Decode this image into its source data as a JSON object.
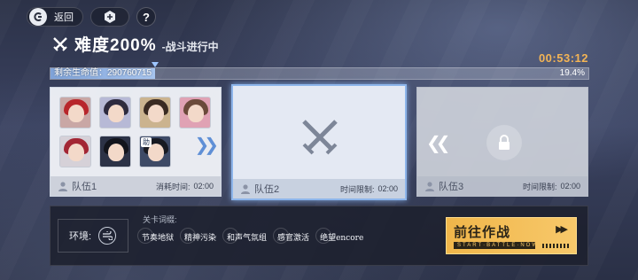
{
  "topbar": {
    "back_label": "返回",
    "help_label": "?"
  },
  "header": {
    "difficulty_title": "难度200%",
    "status": "-战斗进行中",
    "timer": "00:53:12"
  },
  "boss_hp": {
    "label": "剩余生命值：290760715",
    "percent_text": "19.4%",
    "remaining_fraction": 0.194
  },
  "teams": [
    {
      "name": "队伍1",
      "time_label": "消耗时间:",
      "time_value": "02:00",
      "assist_tag": "助"
    },
    {
      "name": "队伍2",
      "time_label": "时间限制:",
      "time_value": "02:00"
    },
    {
      "name": "队伍3",
      "time_label": "时间限制:",
      "time_value": "02:00"
    }
  ],
  "environment": {
    "label": "环境:"
  },
  "affixes": {
    "title": "关卡词缀:",
    "items": [
      "节奏地狱",
      "精神污染",
      "和声气氛组",
      "感官激活",
      "绝望encore"
    ]
  },
  "go_button": {
    "label": "前往作战",
    "sub": "START·BATTLE·NOW"
  },
  "colors": {
    "accent_blue": "#8db5ea",
    "timer_gold": "#f3b455",
    "button_gold": "#f0b64a",
    "hp_fill": "#7fa3d9"
  },
  "icons": {
    "top_home": "return-icon",
    "top_tool": "hexagon-tool-icon",
    "title": "crossed-swords-icon",
    "team2": "crossed-swords-icon",
    "team3": "lock-icon",
    "environment": "wind-icon"
  }
}
